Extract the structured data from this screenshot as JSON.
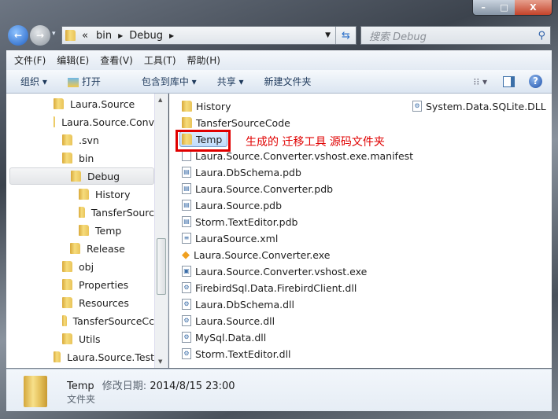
{
  "window": {
    "minimize": "–",
    "maximize": "□",
    "close": "X"
  },
  "address": {
    "chevrons": "«",
    "crumbs": [
      "bin",
      "Debug"
    ]
  },
  "search": {
    "placeholder": "搜索 Debug"
  },
  "menu": [
    "文件(F)",
    "编辑(E)",
    "查看(V)",
    "工具(T)",
    "帮助(H)"
  ],
  "toolbar": {
    "organize": "组织 ▾",
    "open": "打开",
    "include": "包含到库中 ▾",
    "share": "共享 ▾",
    "new_folder": "新建文件夹"
  },
  "tree": [
    {
      "label": "Laura.Source",
      "level": 1
    },
    {
      "label": "Laura.Source.Conv",
      "level": 1
    },
    {
      "label": ".svn",
      "level": 2
    },
    {
      "label": "bin",
      "level": 2
    },
    {
      "label": "Debug",
      "level": 3,
      "selected": true
    },
    {
      "label": "History",
      "level": 4
    },
    {
      "label": "TansferSourc",
      "level": 4
    },
    {
      "label": "Temp",
      "level": 4
    },
    {
      "label": "Release",
      "level": 3
    },
    {
      "label": "obj",
      "level": 2
    },
    {
      "label": "Properties",
      "level": 2
    },
    {
      "label": "Resources",
      "level": 2
    },
    {
      "label": "TansferSourceCc",
      "level": 2
    },
    {
      "label": "Utils",
      "level": 2
    },
    {
      "label": "Laura.Source.Test",
      "level": 1
    }
  ],
  "files": [
    {
      "name": "History",
      "icon": "folder"
    },
    {
      "name": "TansferSourceCode",
      "icon": "folder"
    },
    {
      "name": "Temp",
      "icon": "folder",
      "selected": true
    },
    {
      "name": "Laura.Source.Converter.vshost.exe.manifest",
      "icon": "file"
    },
    {
      "name": "Laura.DbSchema.pdb",
      "icon": "pdb"
    },
    {
      "name": "Laura.Source.Converter.pdb",
      "icon": "pdb"
    },
    {
      "name": "Laura.Source.pdb",
      "icon": "pdb"
    },
    {
      "name": "Storm.TextEditor.pdb",
      "icon": "pdb"
    },
    {
      "name": "LauraSource.xml",
      "icon": "xml"
    },
    {
      "name": "Laura.Source.Converter.exe",
      "icon": "exe"
    },
    {
      "name": "Laura.Source.Converter.vshost.exe",
      "icon": "app"
    },
    {
      "name": "FirebirdSql.Data.FirebirdClient.dll",
      "icon": "dll"
    },
    {
      "name": "Laura.DbSchema.dll",
      "icon": "dll"
    },
    {
      "name": "Laura.Source.dll",
      "icon": "dll"
    },
    {
      "name": "MySql.Data.dll",
      "icon": "dll"
    },
    {
      "name": "Storm.TextEditor.dll",
      "icon": "dll"
    },
    {
      "name": "System.Data.SQLite.DLL",
      "icon": "dll"
    }
  ],
  "annotation": {
    "text": "生成的 迁移工具 源码文件夹",
    "color": "#e00000"
  },
  "status": {
    "name": "Temp",
    "modified_label": "修改日期:",
    "modified": "2014/8/15 23:00",
    "type": "文件夹"
  }
}
